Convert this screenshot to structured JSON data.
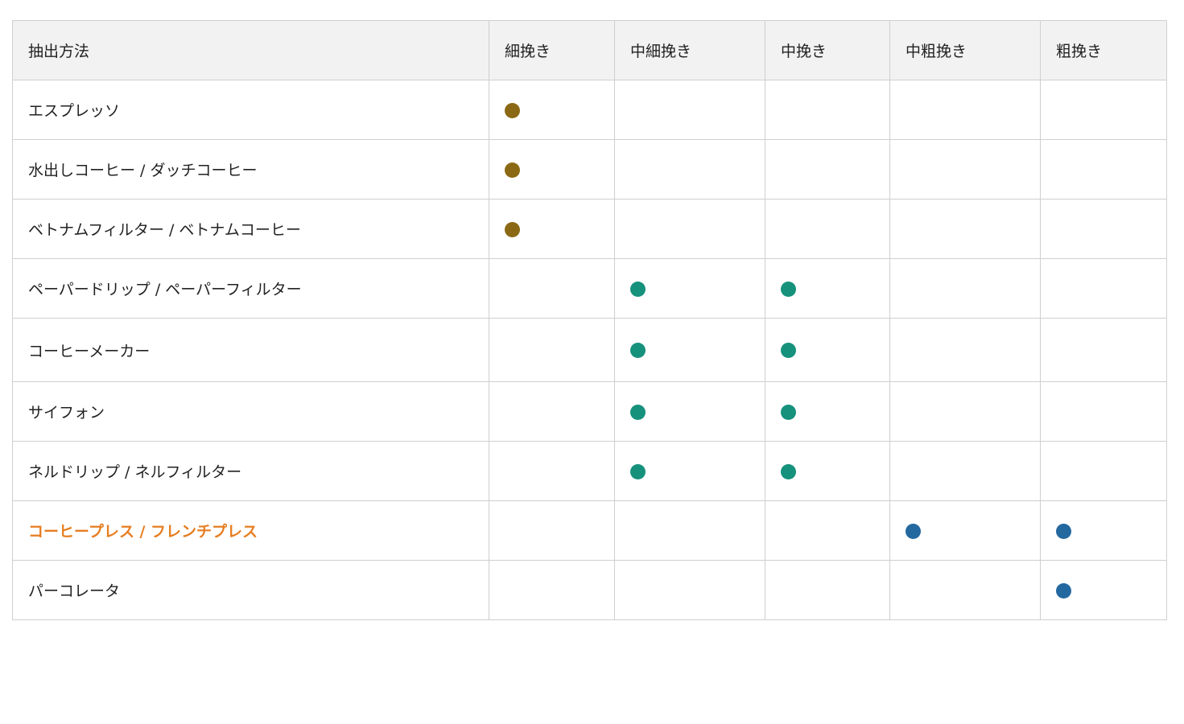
{
  "table": {
    "headers": {
      "method": "抽出方法",
      "fine": "細挽き",
      "medium_fine": "中細挽き",
      "medium": "中挽き",
      "medium_coarse": "中粗挽き",
      "coarse": "粗挽き"
    },
    "colors": {
      "fine_dot": "#8b6914",
      "medium_dot": "#16917c",
      "coarse_dot": "#2468a0",
      "highlight_text": "#e67e22",
      "header_bg": "#f2f2f2",
      "border": "#cfcfcf"
    },
    "rows": [
      {
        "method": "エスプレッソ",
        "fine": true,
        "medium_fine": false,
        "medium": false,
        "medium_coarse": false,
        "coarse": false
      },
      {
        "method": "水出しコーヒー / ダッチコーヒー",
        "fine": true,
        "medium_fine": false,
        "medium": false,
        "medium_coarse": false,
        "coarse": false
      },
      {
        "method": "ベトナムフィルター / ベトナムコーヒー",
        "fine": true,
        "medium_fine": false,
        "medium": false,
        "medium_coarse": false,
        "coarse": false
      },
      {
        "method": "ペーパードリップ / ペーパーフィルター",
        "fine": false,
        "medium_fine": true,
        "medium": true,
        "medium_coarse": false,
        "coarse": false
      },
      {
        "method": "コーヒーメーカー",
        "fine": false,
        "medium_fine": true,
        "medium": true,
        "medium_coarse": false,
        "coarse": false
      },
      {
        "method": "サイフォン",
        "fine": false,
        "medium_fine": true,
        "medium": true,
        "medium_coarse": false,
        "coarse": false
      },
      {
        "method": "ネルドリップ / ネルフィルター",
        "fine": false,
        "medium_fine": true,
        "medium": true,
        "medium_coarse": false,
        "coarse": false
      },
      {
        "method": "コーヒープレス / フレンチプレス",
        "fine": false,
        "medium_fine": false,
        "medium": false,
        "medium_coarse": true,
        "coarse": true,
        "highlighted": true
      },
      {
        "method": "パーコレータ",
        "fine": false,
        "medium_fine": false,
        "medium": false,
        "medium_coarse": false,
        "coarse": true
      }
    ]
  }
}
